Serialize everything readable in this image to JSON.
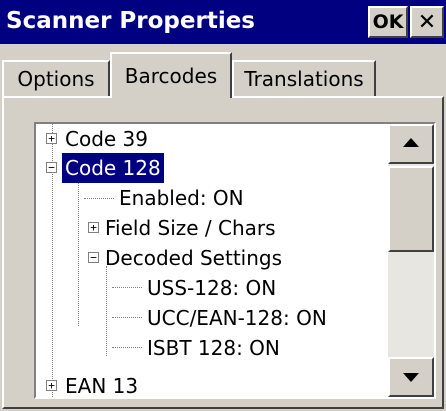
{
  "window": {
    "title": "Scanner Properties",
    "ok_label": "OK",
    "close_label": "✕"
  },
  "tabs": [
    {
      "label": "Options",
      "active": false
    },
    {
      "label": "Barcodes",
      "active": true
    },
    {
      "label": "Translations",
      "active": false
    }
  ],
  "tree": {
    "items": [
      {
        "label": "Code 39",
        "level": 0,
        "expander": "+"
      },
      {
        "label": "Code 128",
        "level": 0,
        "expander": "−",
        "selected": true
      },
      {
        "label": "Enabled: ON",
        "level": 1
      },
      {
        "label": "Field Size / Chars",
        "level": 1,
        "expander": "+"
      },
      {
        "label": "Decoded Settings",
        "level": 1,
        "expander": "−"
      },
      {
        "label": "USS-128: ON",
        "level": 2
      },
      {
        "label": "UCC/EAN-128: ON",
        "level": 2
      },
      {
        "label": "ISBT 128: ON",
        "level": 2
      },
      {
        "label": "EAN 13",
        "level": 0,
        "expander": "+"
      }
    ]
  },
  "colors": {
    "titlebar": "#000080",
    "selection": "#000080",
    "face": "#d4d0c8"
  }
}
